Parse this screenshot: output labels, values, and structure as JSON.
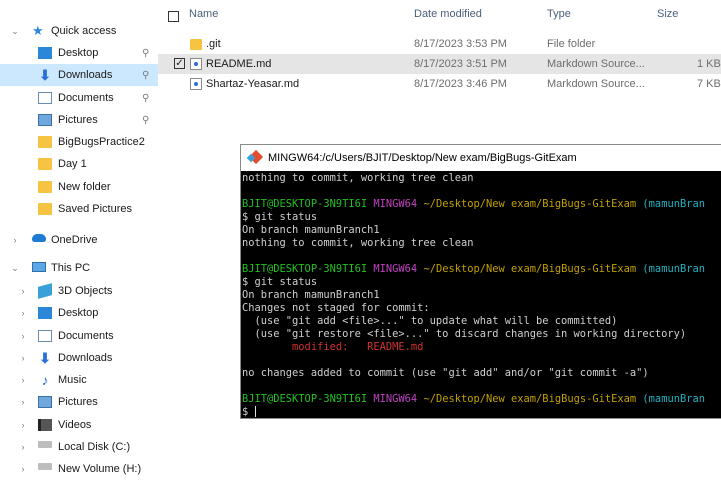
{
  "nav": {
    "items": [
      {
        "label": "Quick access",
        "expanded": true,
        "icon": "star-icon",
        "indent": 0,
        "selected": true
      },
      {
        "label": "Desktop",
        "icon": "desktop-icon",
        "pinned": true,
        "indent": 1
      },
      {
        "label": "Downloads",
        "icon": "downloads-icon",
        "pinned": true,
        "indent": 1,
        "selected": true
      },
      {
        "label": "Documents",
        "icon": "documents-icon",
        "pinned": true,
        "indent": 1
      },
      {
        "label": "Pictures",
        "icon": "pictures-icon",
        "pinned": true,
        "indent": 1
      },
      {
        "label": "BigBugsPractice2",
        "icon": "folder-icon",
        "indent": 1
      },
      {
        "label": "Day 1",
        "icon": "folder-icon",
        "indent": 1
      },
      {
        "label": "New folder",
        "icon": "folder-icon",
        "indent": 1
      },
      {
        "label": "Saved Pictures",
        "icon": "folder-icon",
        "indent": 1
      },
      {
        "label": "OneDrive",
        "icon": "onedrive-icon",
        "indent": 0
      },
      {
        "label": "This PC",
        "expanded": true,
        "icon": "this-pc-icon",
        "indent": 0
      },
      {
        "label": "3D Objects",
        "icon": "3d-objects-icon",
        "indent": 1
      },
      {
        "label": "Desktop",
        "icon": "desktop-icon",
        "indent": 1
      },
      {
        "label": "Documents",
        "icon": "documents-icon",
        "indent": 1
      },
      {
        "label": "Downloads",
        "icon": "downloads-icon",
        "indent": 1
      },
      {
        "label": "Music",
        "icon": "music-icon",
        "indent": 1
      },
      {
        "label": "Pictures",
        "icon": "pictures-icon",
        "indent": 1
      },
      {
        "label": "Videos",
        "icon": "videos-icon",
        "indent": 1
      },
      {
        "label": "Local Disk (C:)",
        "icon": "local-disk-icon",
        "indent": 1
      },
      {
        "label": "New Volume (H:)",
        "icon": "drive-icon",
        "indent": 1
      }
    ]
  },
  "files": {
    "columns": {
      "name": "Name",
      "date": "Date modified",
      "type": "Type",
      "size": "Size"
    },
    "rows": [
      {
        "name": ".git",
        "date": "8/17/2023 3:53 PM",
        "type": "File folder",
        "size": "",
        "icon": "folder-icon"
      },
      {
        "name": "README.md",
        "date": "8/17/2023 3:51 PM",
        "type": "Markdown Source...",
        "size": "1 KB",
        "icon": "markdown-file-icon",
        "selected": true
      },
      {
        "name": "Shartaz-Yeasar.md",
        "date": "8/17/2023 3:46 PM",
        "type": "Markdown Source...",
        "size": "7 KB",
        "icon": "markdown-file-icon"
      }
    ]
  },
  "terminal": {
    "title": "MINGW64:/c/Users/BJIT/Desktop/New exam/BigBugs-GitExam",
    "prompt_user": "BJIT@DESKTOP-3N9TI6I",
    "prompt_env": "MINGW64",
    "prompt_path": "~/Desktop/New exam/BigBugs-GitExam",
    "prompt_branch": "(mamunBran",
    "lines": {
      "l0": "nothing to commit, working tree clean",
      "l1": "$ git status",
      "l2": "On branch mamunBranch1",
      "l3": "nothing to commit, working tree clean",
      "l4": "$ git status",
      "l5": "On branch mamunBranch1",
      "l6": "Changes not staged for commit:",
      "l7": "  (use \"git add <file>...\" to update what will be committed)",
      "l8": "  (use \"git restore <file>...\" to discard changes in working directory)",
      "l9_label": "        modified:",
      "l9_file": "README.md",
      "l10": "no changes added to commit (use \"git add\" and/or \"git commit -a\")",
      "l11": "$ "
    }
  },
  "colors": {
    "selection": "#cce8ff",
    "prompt_green": "#20c020",
    "prompt_magenta": "#c040c0",
    "prompt_yellow": "#c0a000",
    "prompt_cyan": "#20b0c0",
    "modified_red": "#d03030"
  }
}
